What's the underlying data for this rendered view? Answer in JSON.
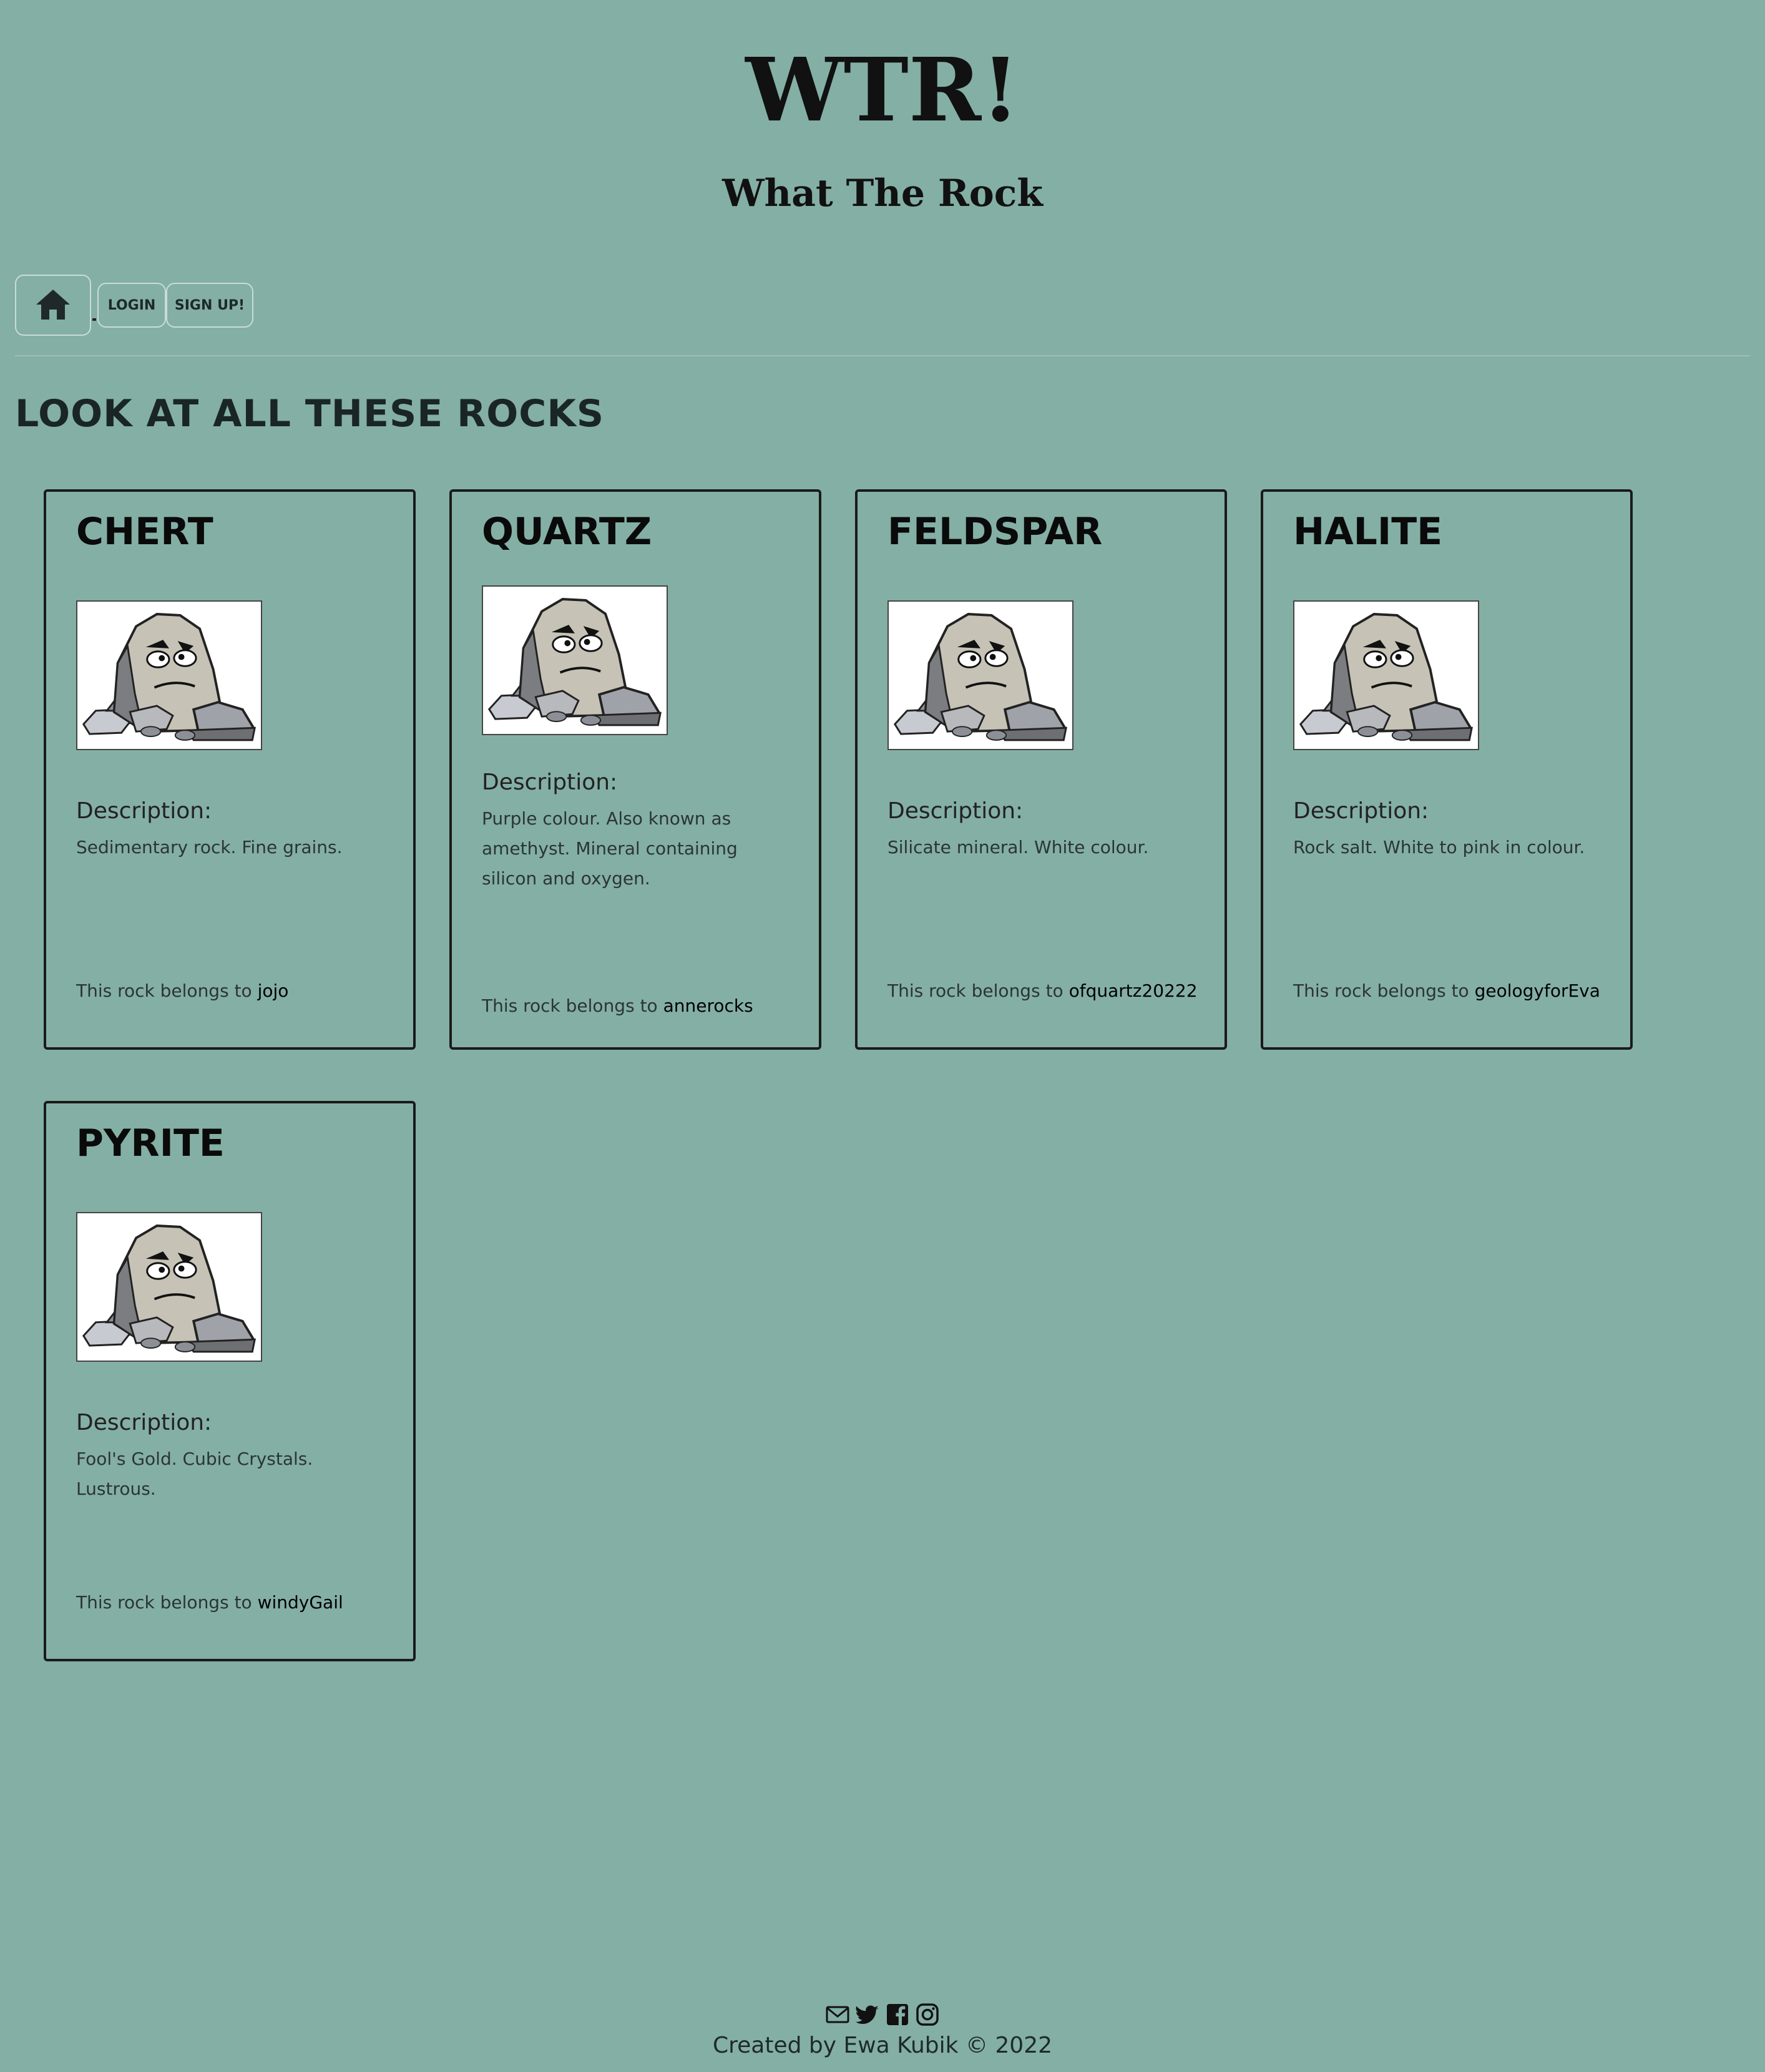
{
  "header": {
    "title": "WTR!",
    "subtitle": "What The Rock"
  },
  "nav": {
    "home_icon": "home-icon",
    "login_label": "LOGIN",
    "signup_label": "SIGN UP!"
  },
  "main": {
    "heading": "LOOK AT ALL THESE ROCKS",
    "description_label": "Description:",
    "owner_prefix": "This rock belongs to",
    "rocks": [
      {
        "name": "CHERT",
        "description": "Sedimentary rock. Fine grains.",
        "owner": "jojo"
      },
      {
        "name": "QUARTZ",
        "description": "Purple colour. Also known as amethyst. Mineral containing silicon and oxygen.",
        "owner": "annerocks"
      },
      {
        "name": "FELDSPAR",
        "description": "Silicate mineral. White colour.",
        "owner": "ofquartz20222"
      },
      {
        "name": "HALITE",
        "description": "Rock salt. White to pink in colour.",
        "owner": "geologyforEva"
      },
      {
        "name": "PYRITE",
        "description": "Fool's Gold. Cubic Crystals. Lustrous.",
        "owner": "windyGail"
      }
    ]
  },
  "footer": {
    "icons": [
      "mail-icon",
      "twitter-icon",
      "facebook-icon",
      "instagram-icon"
    ],
    "credit": "Created by Ewa Kubik © 2022"
  },
  "colors": {
    "background": "#84afa4",
    "card_border": "#1a1a1a"
  }
}
